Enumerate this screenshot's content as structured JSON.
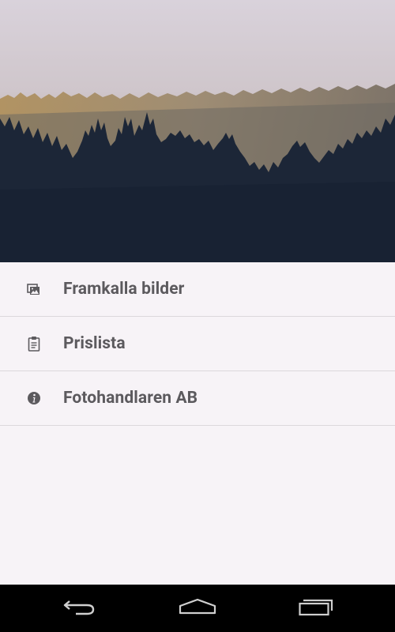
{
  "menu": {
    "items": [
      {
        "label": "Framkalla bilder",
        "icon": "photos-icon"
      },
      {
        "label": "Prislista",
        "icon": "clipboard-icon"
      },
      {
        "label": "Fotohandlaren AB",
        "icon": "info-icon"
      }
    ]
  },
  "colors": {
    "background": "#f7f3f7",
    "text": "#5c5a5e",
    "divider": "#dcd8dc",
    "navbar": "#000000",
    "icon": "#5c5a5e"
  },
  "navbar": {
    "buttons": [
      "back-icon",
      "home-icon",
      "recent-apps-icon"
    ]
  }
}
